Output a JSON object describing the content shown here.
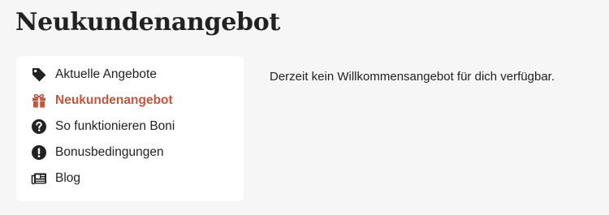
{
  "page": {
    "title": "Neukundenangebot",
    "message": "Derzeit kein Willkommensangebot für dich verfügbar."
  },
  "colors": {
    "background": "#f6f6f6",
    "card": "#ffffff",
    "text": "#222222",
    "accent": "#c8553a"
  },
  "sidebar": {
    "items": [
      {
        "label": "Aktuelle Angebote",
        "icon": "tag-icon",
        "active": false
      },
      {
        "label": "Neukundenangebot",
        "icon": "gift-icon",
        "active": true
      },
      {
        "label": "So funktionieren Boni",
        "icon": "question-circle-icon",
        "active": false
      },
      {
        "label": "Bonusbedingungen",
        "icon": "exclamation-circle-icon",
        "active": false
      },
      {
        "label": "Blog",
        "icon": "newspaper-icon",
        "active": false
      }
    ]
  }
}
